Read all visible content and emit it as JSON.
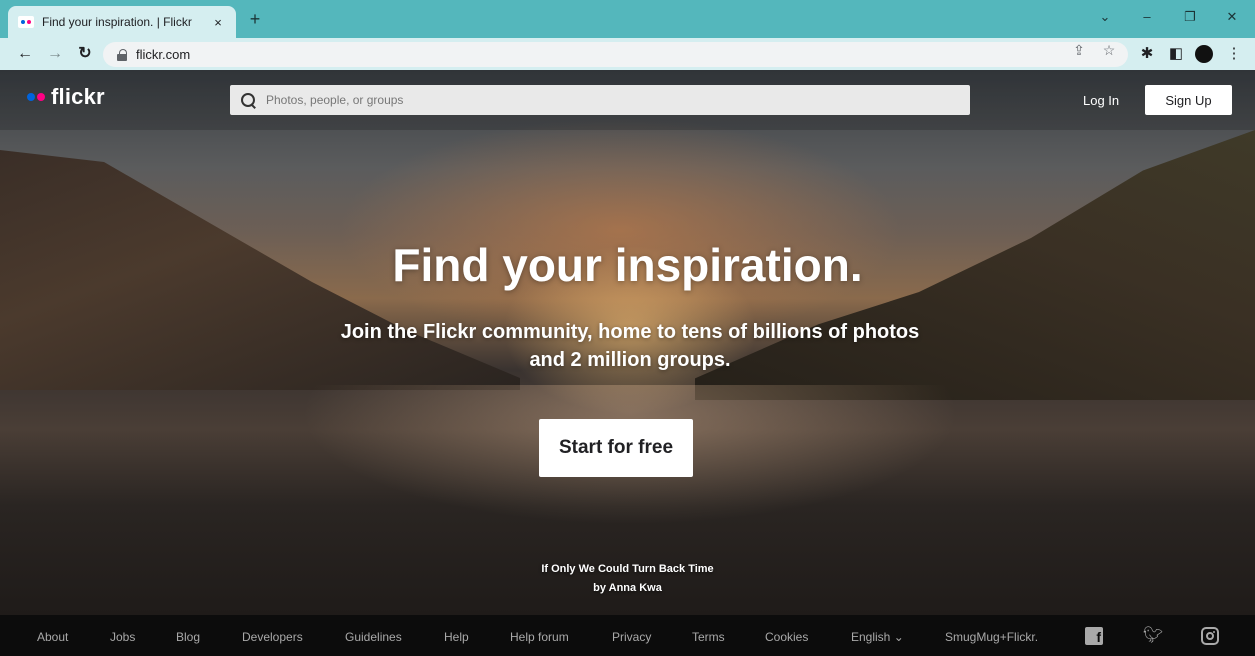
{
  "browser": {
    "tab_title": "Find your inspiration. | Flickr",
    "url": "flickr.com",
    "new_tab": "+",
    "close_tab": "×"
  },
  "header": {
    "logo_text": "flickr",
    "logo_colors": [
      "#0063dc",
      "#ff0084"
    ],
    "search_placeholder": "Photos, people, or groups",
    "login_label": "Log In",
    "signup_label": "Sign Up"
  },
  "hero": {
    "headline": "Find your inspiration.",
    "subheadline": "Join the Flickr community, home to tens of billions of photos and 2 million groups.",
    "cta_label": "Start for free",
    "photo_title": "If Only We Could Turn Back Time",
    "photo_author": "by Anna Kwa"
  },
  "footer": {
    "links": [
      {
        "label": "About"
      },
      {
        "label": "Jobs"
      },
      {
        "label": "Blog"
      },
      {
        "label": "Developers"
      },
      {
        "label": "Guidelines"
      },
      {
        "label": "Help"
      },
      {
        "label": "Help forum"
      },
      {
        "label": "Privacy"
      },
      {
        "label": "Terms"
      },
      {
        "label": "Cookies"
      },
      {
        "label": "English ⌄"
      },
      {
        "label": "SmugMug+Flickr."
      }
    ],
    "social": [
      "facebook-icon",
      "twitter-icon",
      "instagram-icon"
    ]
  }
}
